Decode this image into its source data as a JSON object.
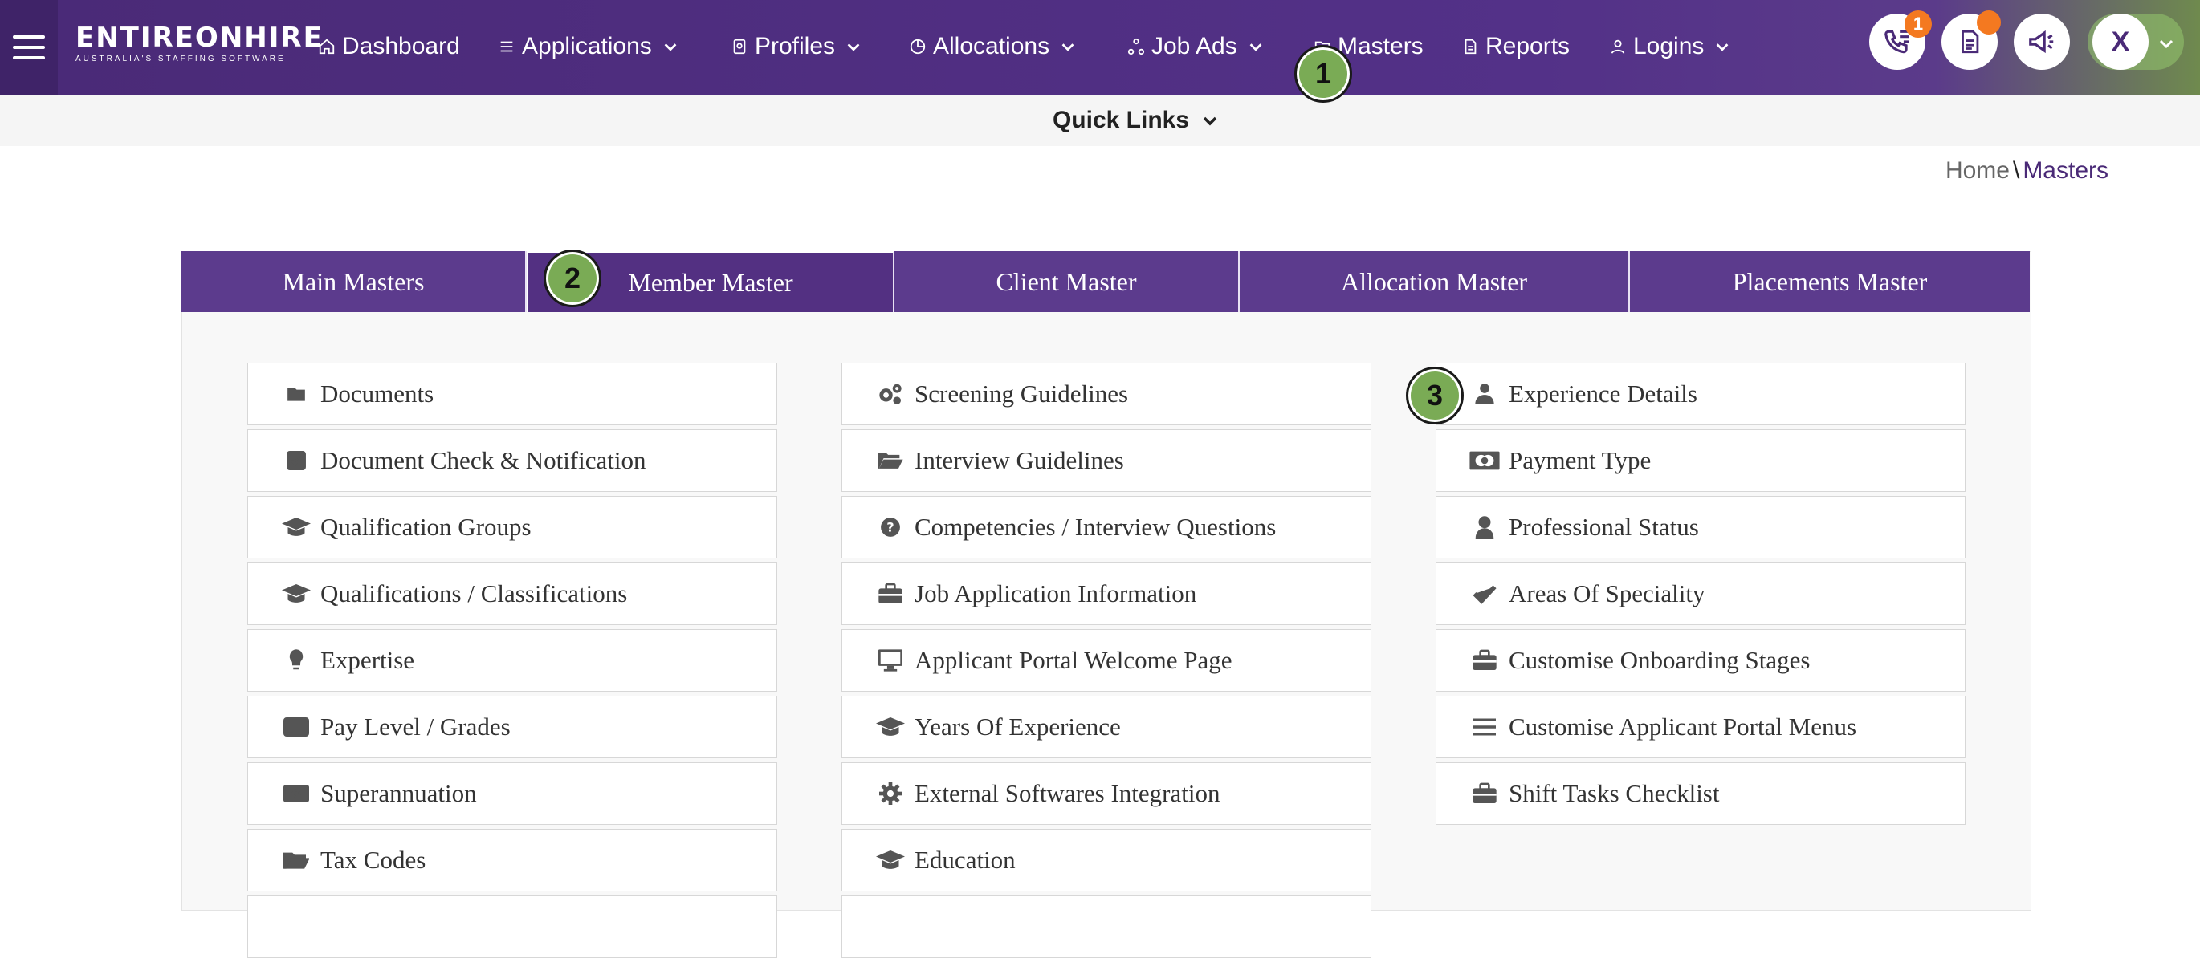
{
  "brand": {
    "name": "ENTIREONHIRE",
    "tagline": "AUSTRALIA'S STAFFING SOFTWARE"
  },
  "nav": {
    "dashboard": "Dashboard",
    "applications": "Applications",
    "profiles": "Profiles",
    "allocations": "Allocations",
    "job_ads": "Job Ads",
    "masters": "Masters",
    "reports": "Reports",
    "logins": "Logins"
  },
  "header_actions": {
    "calls_badge": "1",
    "avatar_initial": "X"
  },
  "quick_links": "Quick Links",
  "breadcrumb": {
    "home": "Home",
    "separator": "\\",
    "current": "Masters"
  },
  "tabs": [
    "Main Masters",
    "Member Master",
    "Client Master",
    "Allocation Master",
    "Placements Master"
  ],
  "columns": {
    "left": [
      {
        "label": "Documents",
        "icon": "folder-icon"
      },
      {
        "label": "Document Check & Notification",
        "icon": "check-square-icon"
      },
      {
        "label": "Qualification Groups",
        "icon": "graduation-cap-icon"
      },
      {
        "label": "Qualifications / Classifications",
        "icon": "graduation-cap-icon"
      },
      {
        "label": "Expertise",
        "icon": "lightbulb-icon"
      },
      {
        "label": "Pay Level / Grades",
        "icon": "credit-card-icon"
      },
      {
        "label": "Superannuation",
        "icon": "money-bill-icon"
      },
      {
        "label": "Tax Codes",
        "icon": "folder-open-icon"
      }
    ],
    "middle": [
      {
        "label": "Screening Guidelines",
        "icon": "cogs-icon"
      },
      {
        "label": "Interview Guidelines",
        "icon": "folder-open-icon"
      },
      {
        "label": "Competencies / Interview Questions",
        "icon": "question-circle-icon"
      },
      {
        "label": "Job Application Information",
        "icon": "briefcase-icon"
      },
      {
        "label": "Applicant Portal Welcome Page",
        "icon": "desktop-icon"
      },
      {
        "label": "Years Of Experience",
        "icon": "graduation-cap-icon"
      },
      {
        "label": "External Softwares Integration",
        "icon": "cog-icon"
      },
      {
        "label": "Education",
        "icon": "graduation-cap-icon"
      }
    ],
    "right": [
      {
        "label": "Experience Details",
        "icon": "user-icon"
      },
      {
        "label": "Payment Type",
        "icon": "money-bill-icon"
      },
      {
        "label": "Professional Status",
        "icon": "user-outline-icon"
      },
      {
        "label": "Areas Of Speciality",
        "icon": "check-icon"
      },
      {
        "label": "Customise Onboarding Stages",
        "icon": "briefcase-icon"
      },
      {
        "label": "Customise Applicant Portal Menus",
        "icon": "bars-icon"
      },
      {
        "label": "Shift Tasks Checklist",
        "icon": "briefcase-icon"
      }
    ]
  },
  "step_markers": [
    "1",
    "2",
    "3"
  ]
}
